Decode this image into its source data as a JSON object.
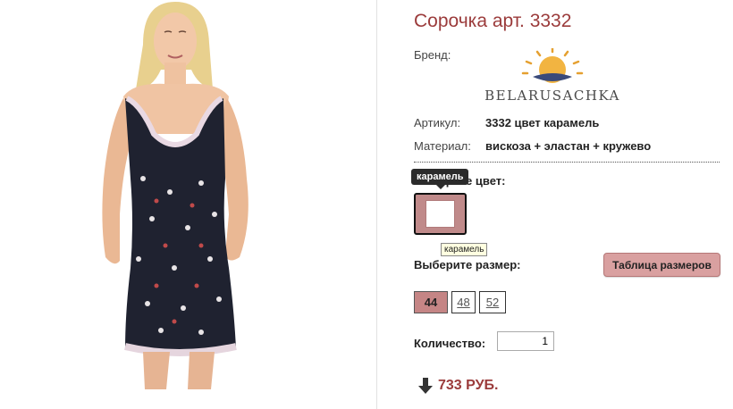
{
  "product": {
    "title": "Сорочка арт. 3332",
    "brand_label": "Бренд:",
    "brand_name": "BELARUSACHKA",
    "article_label": "Артикул:",
    "article_value": "3332 цвет карамель",
    "material_label": "Материал:",
    "material_value": "вискоза + эластан + кружево",
    "photo_icon": "model-in-nightgown-photo"
  },
  "color": {
    "label": "Выберите цвет:",
    "tooltip_dark": "карамель",
    "tooltip_light": "карамель",
    "selected": "карамель",
    "swatch_color": "#c08a8a"
  },
  "size": {
    "label": "Выберите размер:",
    "table_button": "Таблица размеров",
    "options": [
      "44",
      "48",
      "52"
    ],
    "selected": "44"
  },
  "quantity": {
    "label": "Количество:",
    "value": "1"
  },
  "price": {
    "value": "733 РУБ.",
    "icon": "down-arrow-icon"
  },
  "colors": {
    "accent": "#9b3b3b",
    "button": "#d9a0a0",
    "selected_size": "#c58585"
  }
}
